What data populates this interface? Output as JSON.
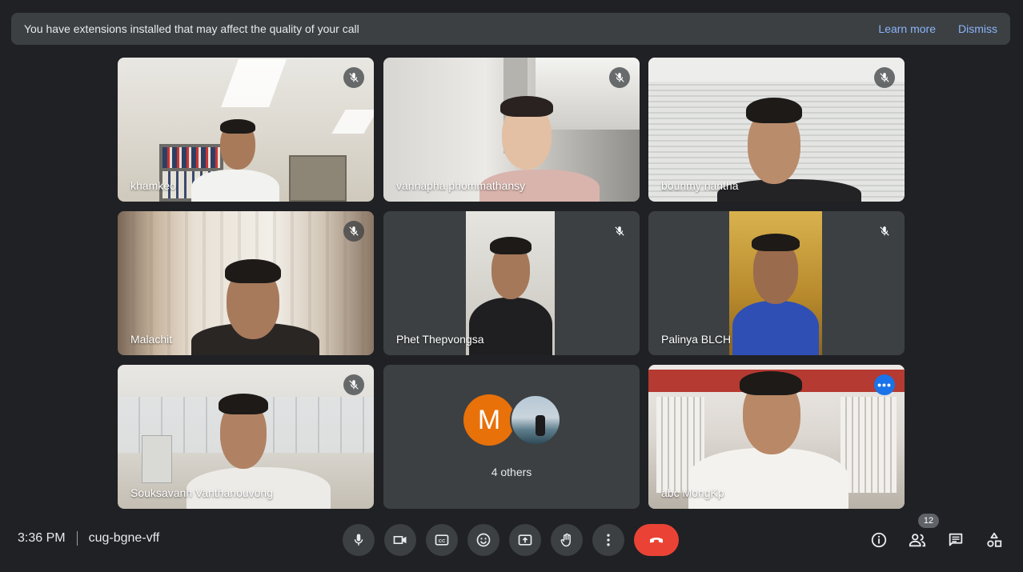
{
  "banner": {
    "message": "You have extensions installed that may affect the quality of your call",
    "learn_more": "Learn more",
    "dismiss": "Dismiss"
  },
  "participants": [
    {
      "name": "khamkeo",
      "muted": true
    },
    {
      "name": "vannapha phommathansy",
      "muted": true
    },
    {
      "name": "bounmy nantha",
      "muted": true
    },
    {
      "name": "Malachit",
      "muted": true
    },
    {
      "name": "Phet Thepvongsa",
      "muted": true
    },
    {
      "name": "Palinya BLCH",
      "muted": true
    },
    {
      "name": "Souksavanh Vanthanouvong",
      "muted": true
    },
    {
      "name": "abc MongKp",
      "muted": false
    }
  ],
  "others_tile": {
    "avatar_letter": "M",
    "label": "4 others"
  },
  "meeting": {
    "time": "3:36 PM",
    "code": "cug-bgne-vff",
    "participant_count": "12"
  },
  "more_options_glyph": "•••",
  "colors": {
    "background": "#202124",
    "tile": "#3c4043",
    "end_call": "#ea4335",
    "link": "#8ab4f8",
    "avatar_m": "#e8710a",
    "selected_outline": "#8ab4f8"
  },
  "icons": [
    "mic-icon",
    "camera-icon",
    "captions-icon",
    "emoji-icon",
    "present-icon",
    "raise-hand-icon",
    "more-vert-icon",
    "end-call-icon",
    "info-icon",
    "people-icon",
    "chat-icon",
    "activities-icon",
    "mic-off-icon"
  ]
}
